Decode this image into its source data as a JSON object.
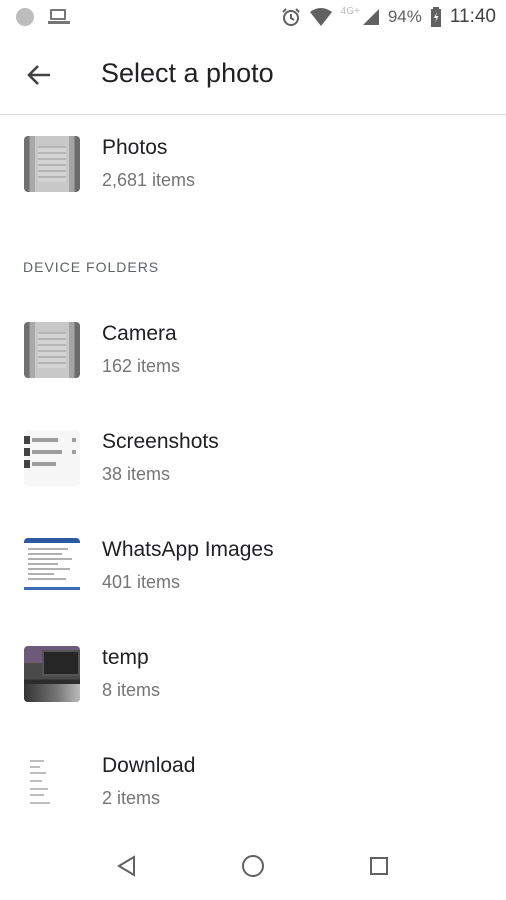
{
  "status_bar": {
    "icons": [
      "circle-dot-icon",
      "laptop-icon",
      "alarm-icon",
      "wifi-icon",
      "signal-icon",
      "battery-icon"
    ],
    "network": "4G+",
    "battery": "94%",
    "time": "11:40"
  },
  "app_bar": {
    "title": "Select a photo",
    "back_icon": "arrow-back-icon"
  },
  "top_album": {
    "title": "Photos",
    "count": "2,681 items"
  },
  "section_label": "DEVICE FOLDERS",
  "folders": [
    {
      "title": "Camera",
      "count": "162 items"
    },
    {
      "title": "Screenshots",
      "count": "38 items"
    },
    {
      "title": "WhatsApp Images",
      "count": "401 items"
    },
    {
      "title": "temp",
      "count": "8 items"
    },
    {
      "title": "Download",
      "count": "2 items"
    }
  ],
  "nav_bar": {
    "buttons": [
      "back-triangle-icon",
      "home-circle-icon",
      "recents-square-icon"
    ]
  },
  "colors": {
    "text_primary": "#202124",
    "text_secondary": "#757575",
    "divider": "#d6d6d6"
  }
}
